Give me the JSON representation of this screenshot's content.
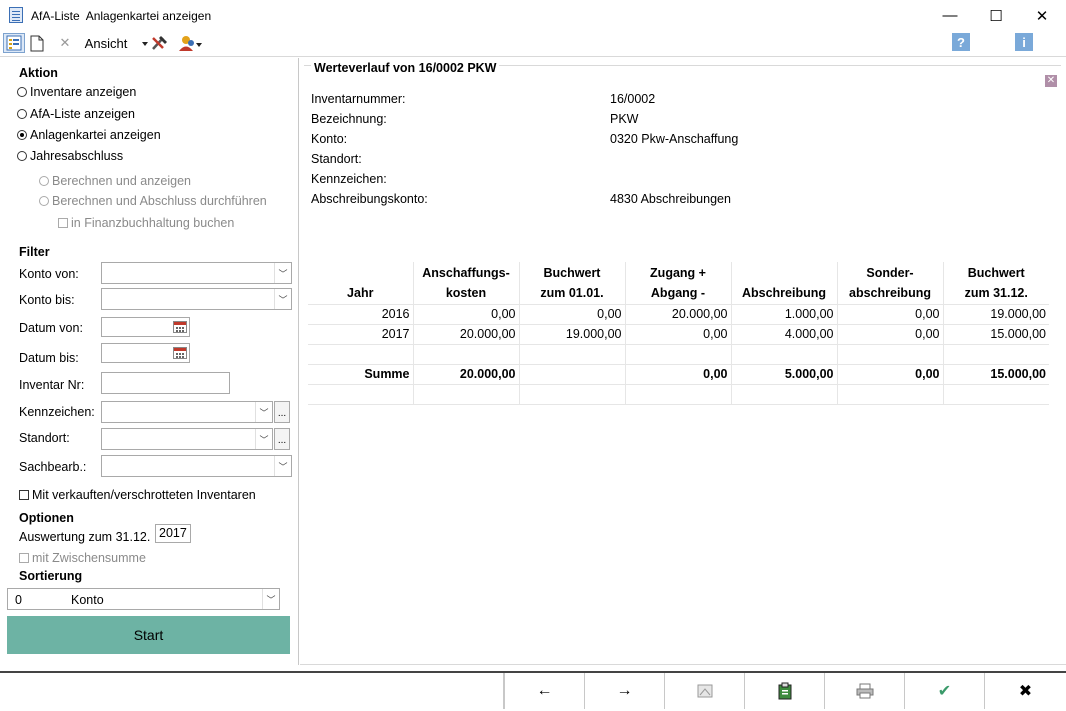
{
  "window": {
    "title": "AfA-Liste  Anlagenkartei anzeigen",
    "minimize": "—",
    "maximize": "☐",
    "close": "✕"
  },
  "toolbar": {
    "view_menu": "Ansicht",
    "help": "?",
    "info": "i"
  },
  "left": {
    "aktion": {
      "heading": "Aktion",
      "options": [
        "Inventare anzeigen",
        "AfA-Liste anzeigen",
        "Anlagenkartei anzeigen",
        "Jahresabschluss"
      ],
      "selected_index": 2,
      "sub_options": [
        "Berechnen und anzeigen",
        "Berechnen und Abschluss durchführen"
      ],
      "fibu_checkbox": "in Finanzbuchhaltung buchen"
    },
    "filter": {
      "heading": "Filter",
      "konto_von": "Konto von:",
      "konto_bis": "Konto bis:",
      "datum_von": "Datum von:",
      "datum_bis": "Datum bis:",
      "inventar_nr": "Inventar Nr:",
      "kennzeichen": "Kennzeichen:",
      "standort": "Standort:",
      "sachbearb": "Sachbearb.:",
      "ellipsis": "...",
      "verkauft_checkbox": "Mit verkauften/verschrotteten Inventaren"
    },
    "optionen": {
      "heading": "Optionen",
      "auswertung_label": "Auswertung zum 31.12.",
      "auswertung_year": "2017",
      "zwischensumme": "mit Zwischensumme"
    },
    "sortierung": {
      "heading": "Sortierung",
      "value_num": "0",
      "value_text": "Konto"
    },
    "start_label": "Start"
  },
  "right": {
    "group_title": "Werteverlauf von 16/0002 PKW",
    "info": [
      {
        "label": "Inventarnummer:",
        "value": "16/0002"
      },
      {
        "label": "Bezeichnung:",
        "value": "PKW"
      },
      {
        "label": "Konto:",
        "value": "0320 Pkw-Anschaffung"
      },
      {
        "label": "Standort:",
        "value": ""
      },
      {
        "label": "Kennzeichen:",
        "value": ""
      },
      {
        "label": "Abschreibungskonto:",
        "value": "4830 Abschreibungen"
      }
    ],
    "table": {
      "headers": [
        {
          "l1": "",
          "l2": "Jahr"
        },
        {
          "l1": "Anschaffungs-",
          "l2": "kosten"
        },
        {
          "l1": "Buchwert",
          "l2": "zum 01.01."
        },
        {
          "l1": "Zugang +",
          "l2": "Abgang -"
        },
        {
          "l1": "",
          "l2": "Abschreibung"
        },
        {
          "l1": "Sonder-",
          "l2": "abschreibung"
        },
        {
          "l1": "Buchwert",
          "l2": "zum 31.12."
        }
      ],
      "rows": [
        [
          "2016",
          "0,00",
          "0,00",
          "20.000,00",
          "1.000,00",
          "0,00",
          "19.000,00"
        ],
        [
          "2017",
          "20.000,00",
          "19.000,00",
          "0,00",
          "4.000,00",
          "0,00",
          "15.000,00"
        ]
      ],
      "sum_row": [
        "Summe",
        "20.000,00",
        "",
        "0,00",
        "5.000,00",
        "0,00",
        "15.000,00"
      ]
    }
  },
  "bottom": {
    "back": "←",
    "forward": "→",
    "ok": "✔",
    "cancel": "✖"
  }
}
